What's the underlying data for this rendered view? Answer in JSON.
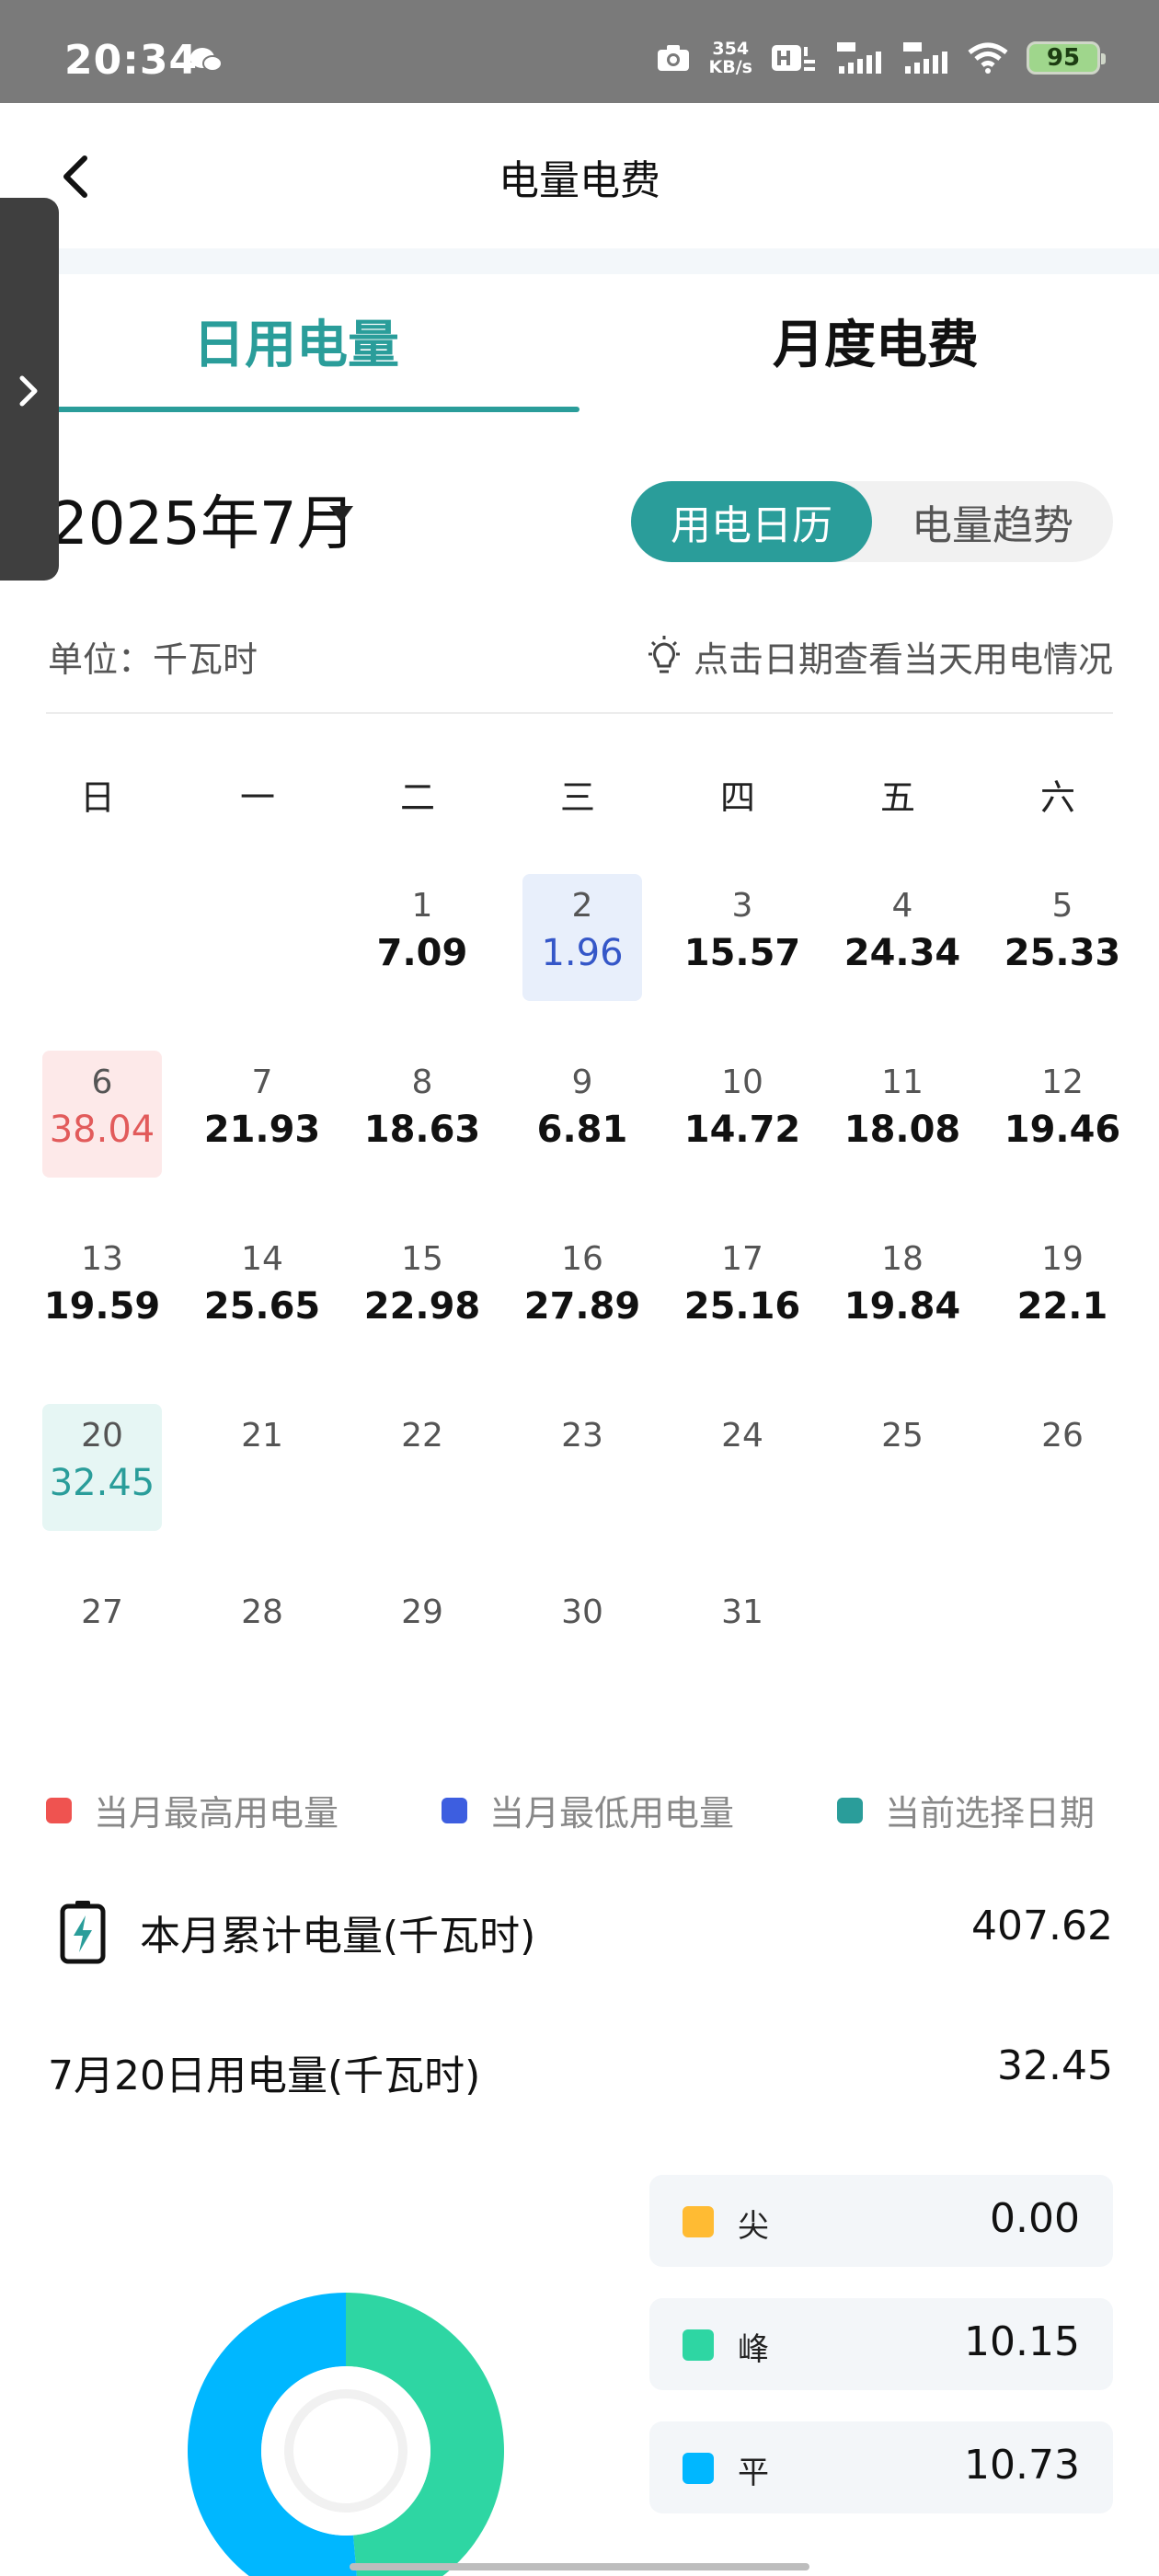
{
  "status_bar": {
    "time": "20:34",
    "net_speed_value": "354",
    "net_speed_unit": "KB/s",
    "battery": "95"
  },
  "header": {
    "title": "电量电费"
  },
  "tabs": [
    {
      "label": "日用电量",
      "active": true
    },
    {
      "label": "月度电费",
      "active": false
    }
  ],
  "month_selector": {
    "label": "2025年7月"
  },
  "view_toggle": {
    "active": "用电日历",
    "inactive": "电量趋势"
  },
  "unit": "单位：千瓦时",
  "hint": "点击日期查看当天用电情况",
  "weekdays": [
    "日",
    "一",
    "二",
    "三",
    "四",
    "五",
    "六"
  ],
  "calendar": {
    "days": [
      {
        "day": "1",
        "value": "7.09"
      },
      {
        "day": "2",
        "value": "1.96",
        "state": "min"
      },
      {
        "day": "3",
        "value": "15.57"
      },
      {
        "day": "4",
        "value": "24.34"
      },
      {
        "day": "5",
        "value": "25.33"
      },
      {
        "day": "6",
        "value": "38.04",
        "state": "max"
      },
      {
        "day": "7",
        "value": "21.93"
      },
      {
        "day": "8",
        "value": "18.63"
      },
      {
        "day": "9",
        "value": "6.81"
      },
      {
        "day": "10",
        "value": "14.72"
      },
      {
        "day": "11",
        "value": "18.08"
      },
      {
        "day": "12",
        "value": "19.46"
      },
      {
        "day": "13",
        "value": "19.59"
      },
      {
        "day": "14",
        "value": "25.65"
      },
      {
        "day": "15",
        "value": "22.98"
      },
      {
        "day": "16",
        "value": "27.89"
      },
      {
        "day": "17",
        "value": "25.16"
      },
      {
        "day": "18",
        "value": "19.84"
      },
      {
        "day": "19",
        "value": "22.1"
      },
      {
        "day": "20",
        "value": "32.45",
        "state": "selected"
      },
      {
        "day": "21",
        "value": ""
      },
      {
        "day": "22",
        "value": ""
      },
      {
        "day": "23",
        "value": ""
      },
      {
        "day": "24",
        "value": ""
      },
      {
        "day": "25",
        "value": ""
      },
      {
        "day": "26",
        "value": ""
      },
      {
        "day": "27",
        "value": ""
      },
      {
        "day": "28",
        "value": ""
      },
      {
        "day": "29",
        "value": ""
      },
      {
        "day": "30",
        "value": ""
      },
      {
        "day": "31",
        "value": ""
      }
    ]
  },
  "legend": [
    {
      "label": "当月最高用电量",
      "color": "#ef5350"
    },
    {
      "label": "当月最低用电量",
      "color": "#3d5ee0"
    },
    {
      "label": "当前选择日期",
      "color": "#2a9d9a"
    }
  ],
  "monthly_total": {
    "label": "本月累计电量(千瓦时)",
    "value": "407.62"
  },
  "selected_day": {
    "label": "7月20日用电量(千瓦时)",
    "value": "32.45"
  },
  "breakdown": [
    {
      "label": "尖",
      "value": "0.00",
      "color": "#ffbb33"
    },
    {
      "label": "峰",
      "value": "10.15",
      "color": "#2ed6a3"
    },
    {
      "label": "平",
      "value": "10.73",
      "color": "#00b7ff"
    }
  ],
  "chart_data": {
    "type": "pie",
    "categories": [
      "尖",
      "峰",
      "平"
    ],
    "values": [
      0.0,
      10.15,
      10.73
    ],
    "colors": [
      "#ffbb33",
      "#2ed6a3",
      "#00b7ff"
    ]
  }
}
